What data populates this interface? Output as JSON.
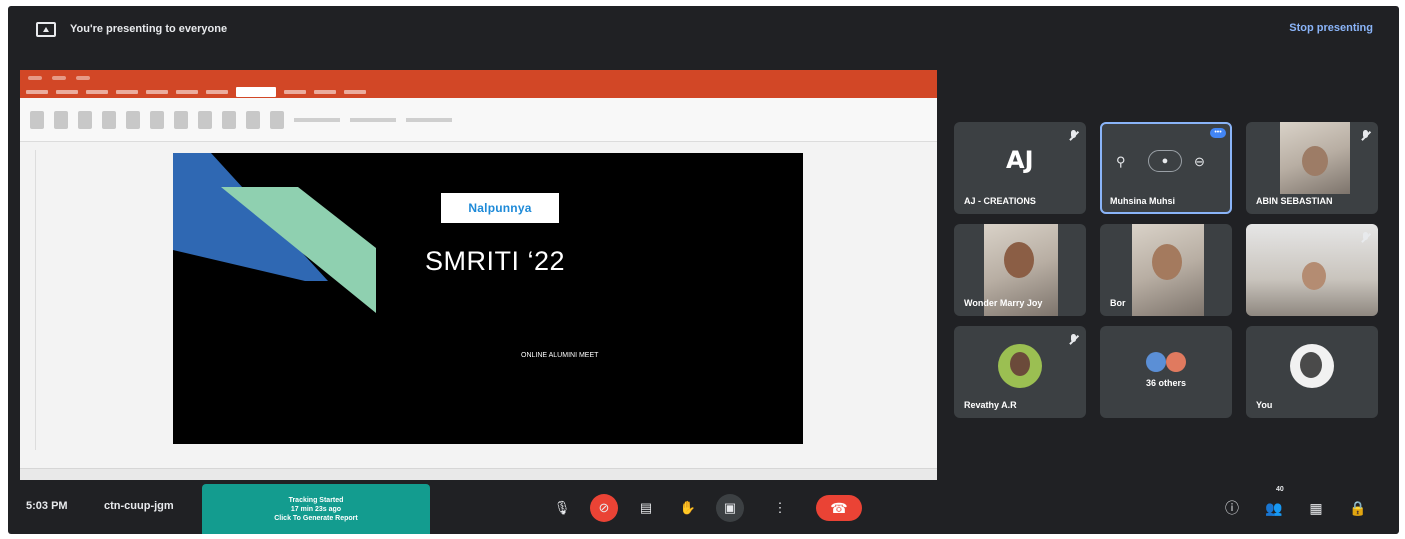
{
  "topbar": {
    "presenting_text": "You're presenting to everyone",
    "stop_label": "Stop presenting"
  },
  "slide": {
    "logo_text": "Nalpunnya",
    "title": "SMRITI ‘22",
    "subtitle": "ONLINE ALUMINI MEET",
    "shape_colors": {
      "blue": "#2f68b3",
      "mint": "#8fd0b0"
    }
  },
  "participants": [
    {
      "name": "AJ - CREATIONS",
      "muted": true,
      "logo": "AJ"
    },
    {
      "name": "Muhsina Muhsi",
      "speaking": true
    },
    {
      "name": "ABIN SEBASTIAN",
      "muted": true
    },
    {
      "name": "Wonder Marry Joy"
    },
    {
      "name": "Bor"
    },
    {
      "name": "",
      "muted": true
    },
    {
      "name": "Revathy A.R",
      "muted": true
    },
    {
      "name": "36 others"
    },
    {
      "name": "You"
    }
  ],
  "bottombar": {
    "time": "5:03 PM",
    "meeting_code": "ctn-cuup-jgm",
    "tracking": {
      "line1": "Tracking Started",
      "line2": "17 min 23s ago",
      "line3": "Click To Generate Report"
    },
    "people_count": "40"
  },
  "colors": {
    "accent_blue": "#8ab4f8",
    "end_call_red": "#ea4335",
    "tracking_teal": "#139c8f",
    "background": "#202124"
  }
}
